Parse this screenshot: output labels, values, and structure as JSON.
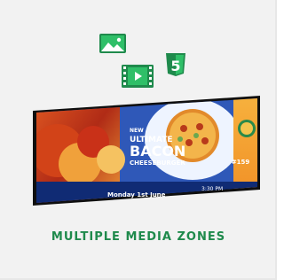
{
  "caption": {
    "text": "MULTIPLE MEDIA ZONES"
  },
  "icons": {
    "image": "image-icon",
    "video": "video-icon",
    "html5": "html5-icon",
    "html5_label": "5"
  },
  "screen": {
    "badge": "NEW",
    "line1": "ULTIMATE",
    "line2": "BACON",
    "line3": "CHEESEBURGER",
    "date": "Monday 1st June",
    "time": "3:30 PM",
    "price": "#159"
  },
  "colors": {
    "accent": "#1f8a4c",
    "screen_blue": "#2f58b8",
    "screen_orange": "#f39a2b",
    "screen_dark": "#101010"
  }
}
